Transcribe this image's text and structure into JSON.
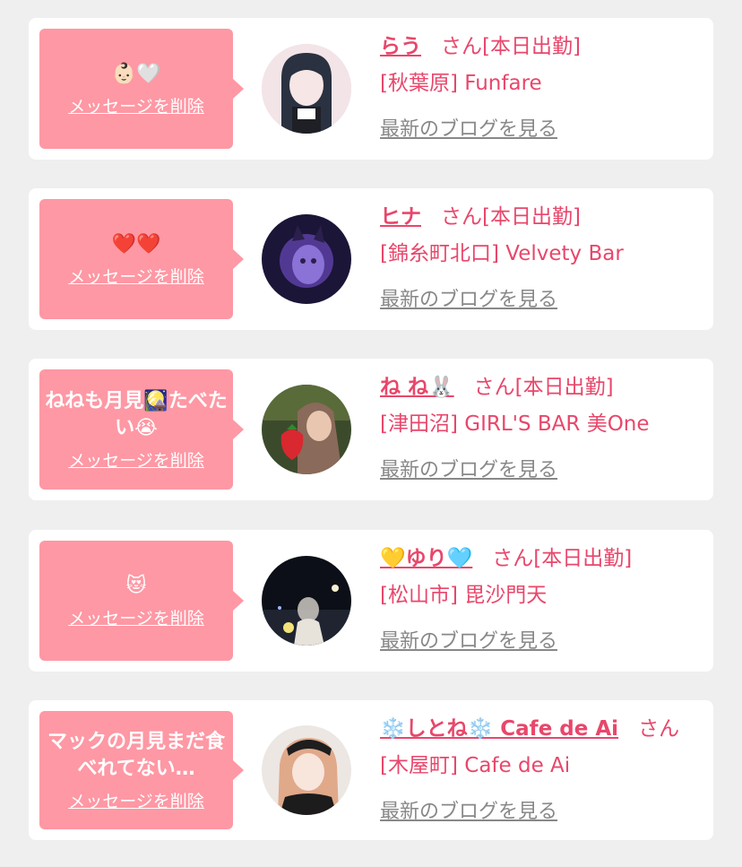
{
  "cards": [
    {
      "message": "👶🏻🤍",
      "delete_label": "メッセージを削除",
      "name": "らう",
      "honorific": "さん",
      "status": "[本日出勤]",
      "shop": "[秋葉原] Funfare",
      "blog_label": "最新のブログを見る"
    },
    {
      "message": "❤️❤️",
      "delete_label": "メッセージを削除",
      "name": "ヒナ",
      "honorific": "さん",
      "status": "[本日出勤]",
      "shop": "[錦糸町北口] Velvety Bar",
      "blog_label": "最新のブログを見る"
    },
    {
      "message": "ねねも月見🎑たべたい😭",
      "delete_label": "メッセージを削除",
      "name": "ね ね🐰",
      "honorific": "さん",
      "status": "[本日出勤]",
      "shop": "[津田沼] GIRL'S BAR 美One",
      "blog_label": "最新のブログを見る"
    },
    {
      "message": "😻",
      "delete_label": "メッセージを削除",
      "name": "💛ゆり🩵",
      "honorific": "さん",
      "status": "[本日出勤]",
      "shop": "[松山市] 毘沙門天",
      "blog_label": "最新のブログを見る"
    },
    {
      "message": "マックの月見まだ食べれてない…",
      "delete_label": "メッセージを削除",
      "name": "❄️しとね❄️ Cafe de Ai",
      "honorific": "さん",
      "status": "",
      "shop": "[木屋町] Cafe de Ai",
      "blog_label": "最新のブログを見る"
    }
  ],
  "colors": {
    "page_background": "#efefef",
    "bubble": "#fe98a4",
    "accent": "#e8476b",
    "link_gray": "#888888"
  }
}
